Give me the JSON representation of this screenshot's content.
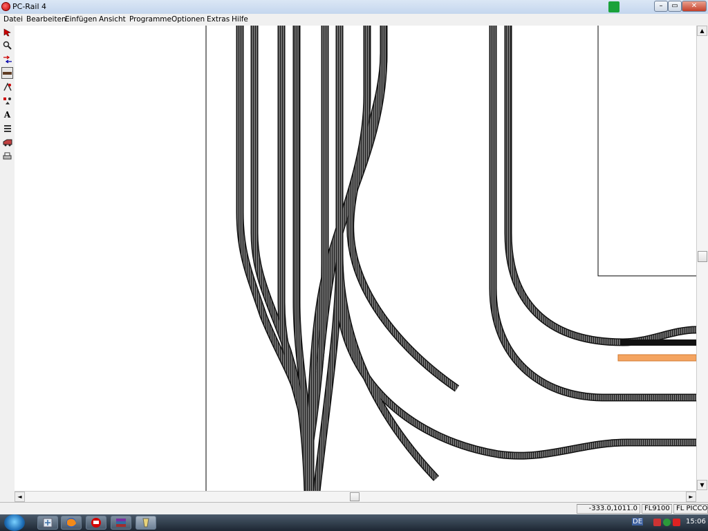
{
  "window": {
    "title": "PC-Rail 4",
    "controls": {
      "minimize": "–",
      "maximize": "▭",
      "close": "✕"
    }
  },
  "menu": [
    "Datei",
    "Bearbeiten",
    "Einfügen",
    "Ansicht",
    "Programme",
    "Optionen",
    "Extras",
    "Hilfe"
  ],
  "toolbar": {
    "tools": [
      "select-arrow-icon",
      "zoom-icon",
      "route-icon",
      "track-icon",
      "switch-icon",
      "signal-icon",
      "text-icon",
      "layers-icon",
      "locomotive-icon",
      "print-icon"
    ],
    "text_tool_label": "A"
  },
  "scroll": {
    "up": "▲",
    "down": "▼",
    "left": "◄",
    "right": "►"
  },
  "status": {
    "coords": "-333.0,1011.0",
    "part": "FL9100",
    "catalog": "FL PICCOLO"
  },
  "taskbar": {
    "lang": "DE",
    "clock": "15:06",
    "apps": [
      "explorer-icon",
      "firefox-icon",
      "pcrail-icon",
      "winrar-icon",
      "other-app-icon"
    ]
  },
  "colors": {
    "track_ballast": "#7a7a7a",
    "track_ties": "#222222",
    "highlight_track": "#f4a460",
    "accent": "#1aa23a"
  }
}
